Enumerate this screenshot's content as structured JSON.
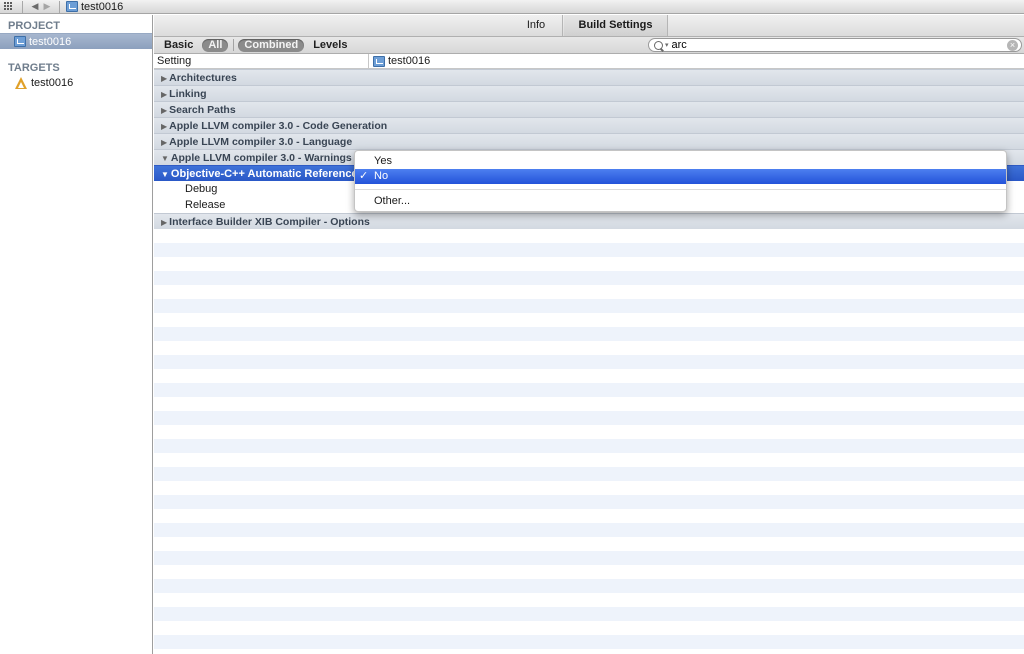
{
  "jumpbar": {
    "project": "test0016"
  },
  "sidebar": {
    "project_header": "PROJECT",
    "project_name": "test0016",
    "targets_header": "TARGETS",
    "target_name": "test0016"
  },
  "tabs": {
    "info": "Info",
    "build_settings": "Build Settings"
  },
  "filter": {
    "basic": "Basic",
    "all": "All",
    "combined": "Combined",
    "levels": "Levels",
    "search_value": "arc"
  },
  "columns": {
    "setting": "Setting",
    "target": "test0016"
  },
  "groups": [
    "Architectures",
    "Linking",
    "Search Paths",
    "Apple LLVM compiler 3.0 - Code Generation",
    "Apple LLVM compiler 3.0 - Language",
    "Apple LLVM compiler 3.0 - Warnings"
  ],
  "selected_setting": "Objective-C++ Automatic Reference C",
  "sub_rows": [
    "Debug",
    "Release"
  ],
  "last_group": "Interface Builder XIB Compiler - Options",
  "popup": {
    "yes": "Yes",
    "no": "No",
    "other": "Other...",
    "check": "✓"
  },
  "colors": {
    "selection": "#2a58c7",
    "group_bg": "#d3d9e1",
    "stripe": "#eef3fb"
  }
}
